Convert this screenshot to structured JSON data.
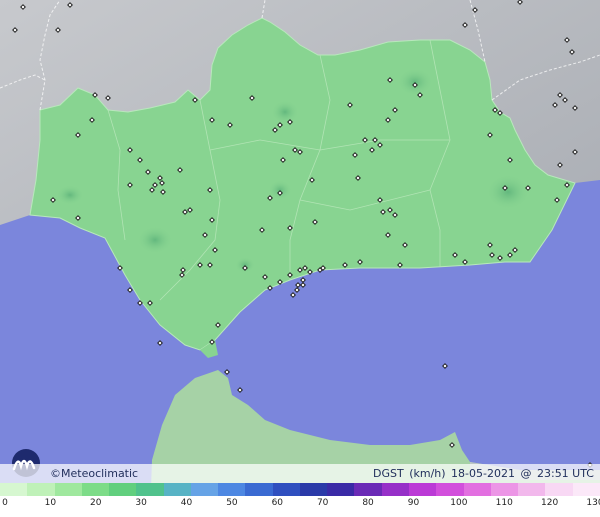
{
  "legend": {
    "brand": "©Meteoclimatic",
    "variable": "DGST",
    "unit": "(km/h)",
    "date": "18-05-2021",
    "at": "@",
    "time": "23:51 UTC"
  },
  "scale": {
    "ticks": [
      "0",
      "10",
      "20",
      "30",
      "40",
      "50",
      "60",
      "70",
      "80",
      "90",
      "100",
      "110",
      "120",
      "130"
    ],
    "colors": [
      "#d6f7d0",
      "#bff1b8",
      "#9fe89e",
      "#7ddc88",
      "#61cf7e",
      "#50c28c",
      "#57b3c5",
      "#66a3e6",
      "#4d87e2",
      "#3a6ad2",
      "#2f4fbf",
      "#2a3aa8",
      "#3a2aa6",
      "#6a2ab6",
      "#9630c8",
      "#bb3ad6",
      "#d24fdc",
      "#e26fe0",
      "#ec96e6",
      "#f2b8ec",
      "#f8d8f4",
      "#fbe8f8"
    ]
  },
  "colors": {
    "sea": "#7b86dc",
    "land_andalusia": "#88d491",
    "land_other": "#b4b8be",
    "morocco": "#a7d7a8",
    "station": "#111111"
  }
}
